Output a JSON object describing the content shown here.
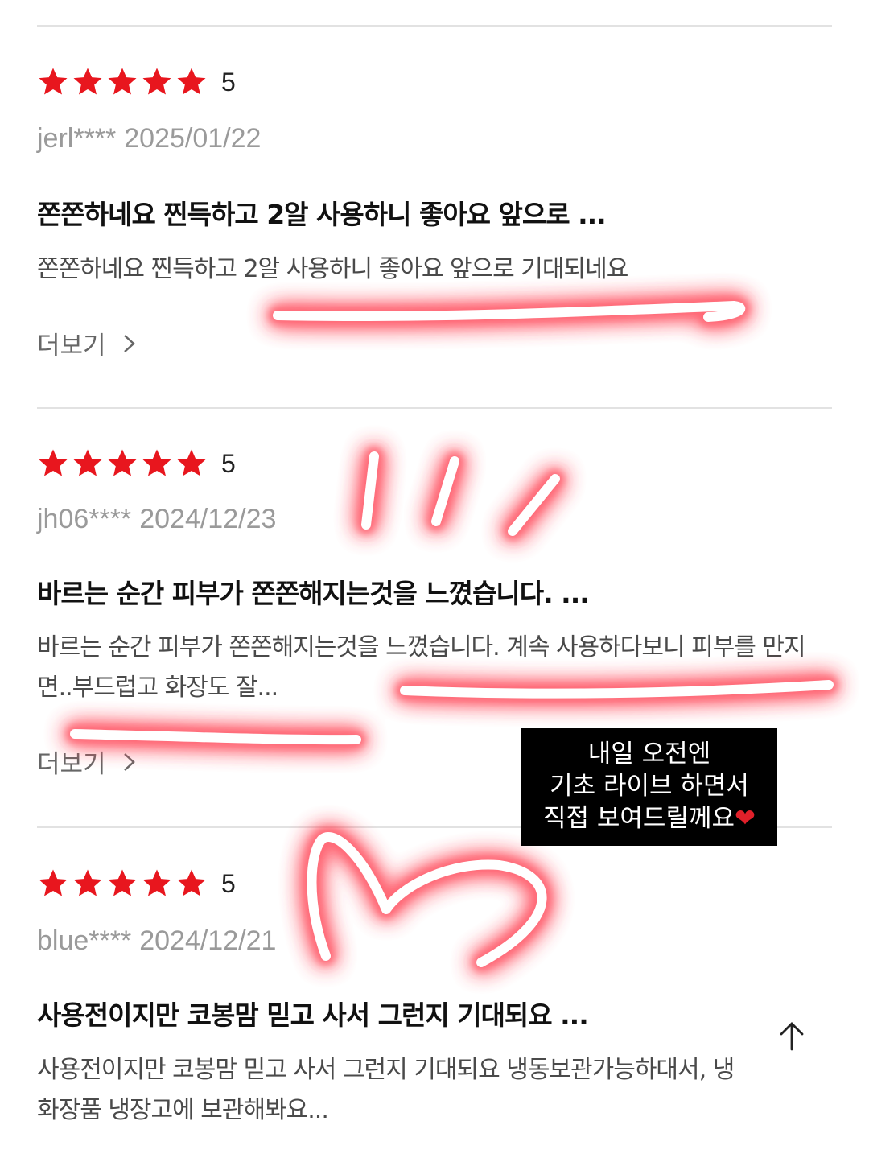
{
  "reviews": [
    {
      "rating": "5",
      "stars_filled": 5,
      "user": "jerl****",
      "date": "2025/01/22",
      "title": "쫀쫀하네요 찐득하고 2알 사용하니 좋아요 앞으로 ...",
      "body": "쫀쫀하네요 찐득하고 2알 사용하니 좋아요 앞으로 기대되네요",
      "more_label": "더보기"
    },
    {
      "rating": "5",
      "stars_filled": 5,
      "user": "jh06****",
      "date": "2024/12/23",
      "title": "바르는 순간 피부가 쫀쫀해지는것을 느꼈습니다. ...",
      "body": "바르는 순간 피부가 쫀쫀해지는것을 느꼈습니다. 계속 사용하다보니 피부를 만지면..부드럽고 화장도 잘...",
      "more_label": "더보기"
    },
    {
      "rating": "5",
      "stars_filled": 5,
      "user": "blue****",
      "date": "2024/12/21",
      "title": "사용전이지만 코봉맘 믿고 사서 그런지 기대되요 ...",
      "body": "사용전이지만 코봉맘 믿고 사서 그런지 기대되요 냉동보관가능하대서, 냉\n화장품 냉장고에 보관해봐요..."
    }
  ],
  "caption": {
    "line1": "내일 오전엔",
    "line2": "기초 라이브 하면서",
    "line3": "직접 보여드릴께요",
    "heart": "❤"
  },
  "colors": {
    "star": "#e8161e",
    "glow": "#ff4f5e",
    "caption_bg": "#000000"
  },
  "icons": {
    "star": "star-icon",
    "chevron": "chevron-right-icon",
    "scroll_top": "arrow-up-icon"
  }
}
